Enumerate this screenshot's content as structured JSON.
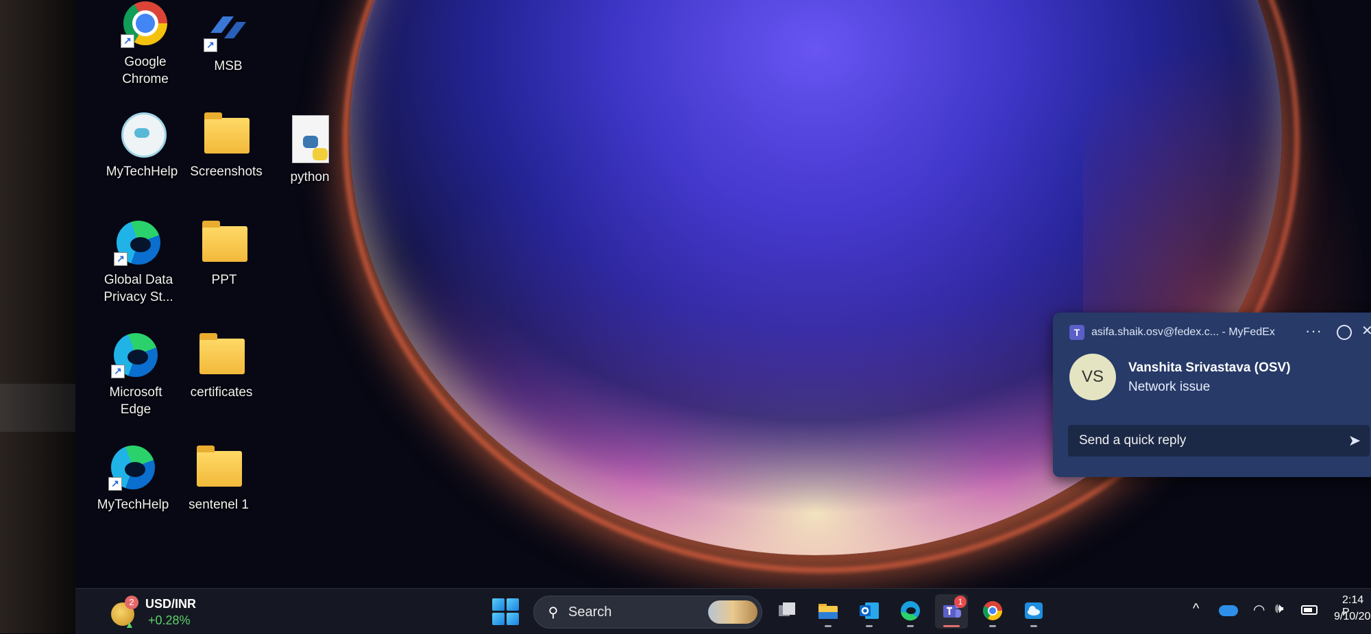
{
  "desktop": {
    "icons": [
      {
        "label": "Google\nChrome",
        "icon": "chrome-icon"
      },
      {
        "label": "MSB",
        "icon": "msb-icon"
      },
      {
        "label": "MyTechHelp",
        "icon": "mytechhelp-bot-icon"
      },
      {
        "label": "Screenshots",
        "icon": "folder-icon"
      },
      {
        "label": "python",
        "icon": "python-file-icon"
      },
      {
        "label": "Global Data\nPrivacy St...",
        "icon": "edge-icon"
      },
      {
        "label": "PPT",
        "icon": "folder-icon"
      },
      {
        "label": "Microsoft\nEdge",
        "icon": "edge-icon"
      },
      {
        "label": "certificates",
        "icon": "folder-icon"
      },
      {
        "label": "MyTechHelp",
        "icon": "edge-icon"
      },
      {
        "label": "sentenel 1",
        "icon": "zip-folder-icon"
      }
    ]
  },
  "notification": {
    "app_icon": "teams-icon",
    "source": "asifa.shaik.osv@fedex.c... - MyFedEx",
    "more": "···",
    "avatar_initials": "VS",
    "sender": "Vanshita Srivastava (OSV)",
    "message": "Network issue",
    "reply_placeholder": "Send a quick reply",
    "send_icon": "send-icon"
  },
  "taskbar": {
    "widget": {
      "badge": "2",
      "title": "USD/INR",
      "change": "+0.28%",
      "icon": "coins-icon"
    },
    "search_placeholder": "Search",
    "apps": [
      {
        "name": "task-view",
        "icon": "task-view-icon"
      },
      {
        "name": "file-explorer",
        "icon": "folder-icon"
      },
      {
        "name": "outlook",
        "icon": "outlook-icon"
      },
      {
        "name": "edge",
        "icon": "edge-icon"
      },
      {
        "name": "teams",
        "icon": "teams-icon",
        "badge": "1",
        "active": true
      },
      {
        "name": "chrome",
        "icon": "chrome-icon"
      },
      {
        "name": "cloud-app",
        "icon": "cloud-icon"
      }
    ],
    "tray": {
      "chevron": "^",
      "wifi": "wifi-icon",
      "volume": "volume-icon",
      "battery": "battery-icon"
    },
    "clock": {
      "time": "2:14 P",
      "date": "9/10/20"
    }
  },
  "colors": {
    "toast_bg": "#273a68",
    "taskbar_bg": "#151822",
    "widget_positive": "#5ed16a",
    "badge_red": "#e64b4b"
  }
}
